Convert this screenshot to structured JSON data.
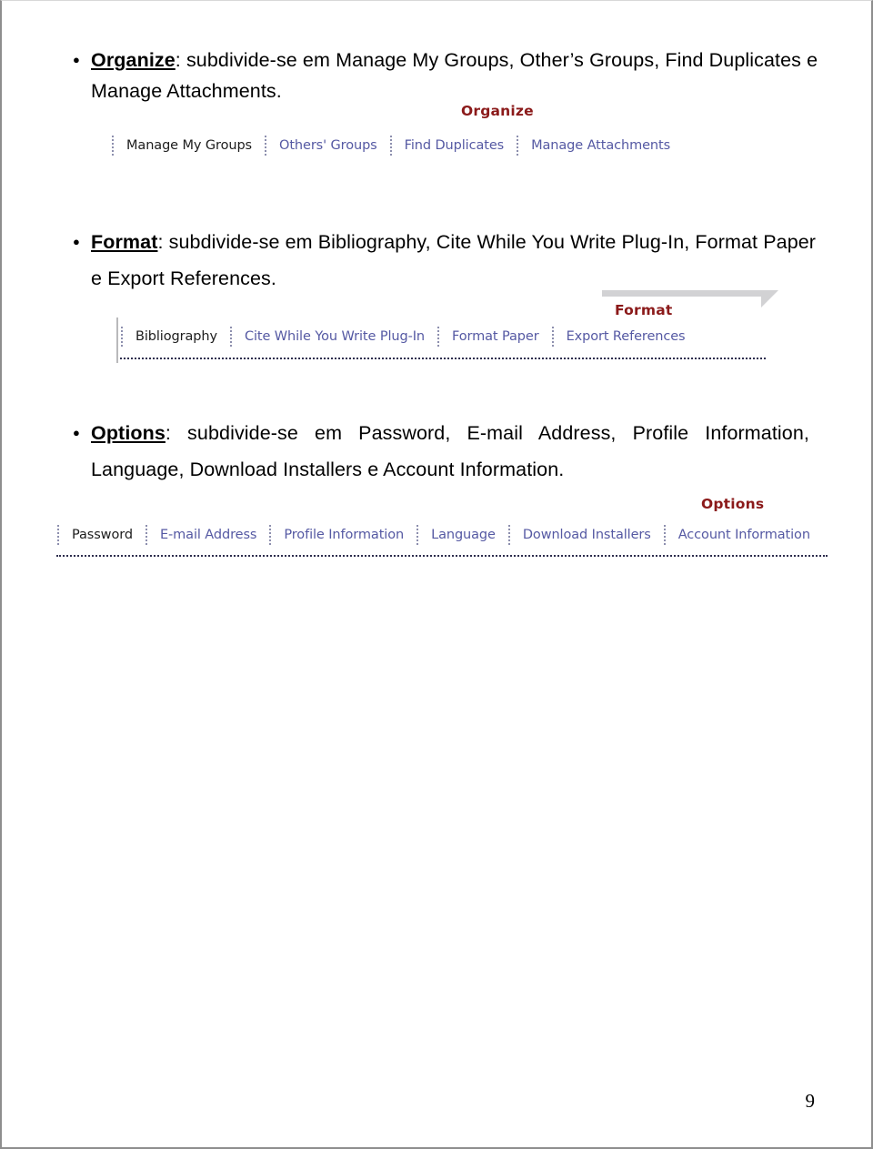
{
  "page": {
    "number": "9"
  },
  "sections": [
    {
      "id": "organize",
      "bullet_glyph": "bullet-dot",
      "paragraph": {
        "keyword": "Organize",
        "rest": ": subdivide-se em Manage My Groups, Other’s Groups, Find Duplicates e Manage Attachments."
      },
      "toolbar": {
        "caption": "Organize",
        "caption_color": "#8b1a1a",
        "link_color": "#5559a3",
        "active_color": "#1d1d1d",
        "has_graybar": false,
        "has_underline": false,
        "items": [
          {
            "label": "Manage My Groups",
            "active": true
          },
          {
            "label": "Others' Groups",
            "active": false
          },
          {
            "label": "Find Duplicates",
            "active": false
          },
          {
            "label": "Manage Attachments",
            "active": false
          }
        ]
      }
    },
    {
      "id": "format",
      "bullet_glyph": "bullet-dot",
      "paragraph": {
        "keyword": "Format",
        "rest": ": subdivide-se em Bibliography, Cite While You Write Plug-In, Format Paper e Export References."
      },
      "toolbar": {
        "caption": "Format",
        "caption_color": "#8b1a1a",
        "link_color": "#5559a3",
        "active_color": "#1d1d1d",
        "has_graybar": true,
        "has_underline": true,
        "items": [
          {
            "label": "Bibliography",
            "active": true
          },
          {
            "label": "Cite While You Write Plug-In",
            "active": false
          },
          {
            "label": "Format Paper",
            "active": false
          },
          {
            "label": "Export References",
            "active": false
          }
        ]
      }
    },
    {
      "id": "options",
      "bullet_glyph": "bullet-dot",
      "paragraph": {
        "keyword": "Options",
        "rest": ": subdivide-se em Password, E-mail Address, Profile Information, Language, Download Installers e Account Information."
      },
      "toolbar": {
        "caption": "Options",
        "caption_color": "#8b1a1a",
        "link_color": "#5559a3",
        "active_color": "#1d1d1d",
        "has_graybar": false,
        "has_underline": true,
        "items": [
          {
            "label": "Password",
            "active": true
          },
          {
            "label": "E-mail Address",
            "active": false
          },
          {
            "label": "Profile Information",
            "active": false
          },
          {
            "label": "Language",
            "active": false
          },
          {
            "label": "Download Installers",
            "active": false
          },
          {
            "label": "Account Information",
            "active": false
          }
        ]
      }
    }
  ]
}
